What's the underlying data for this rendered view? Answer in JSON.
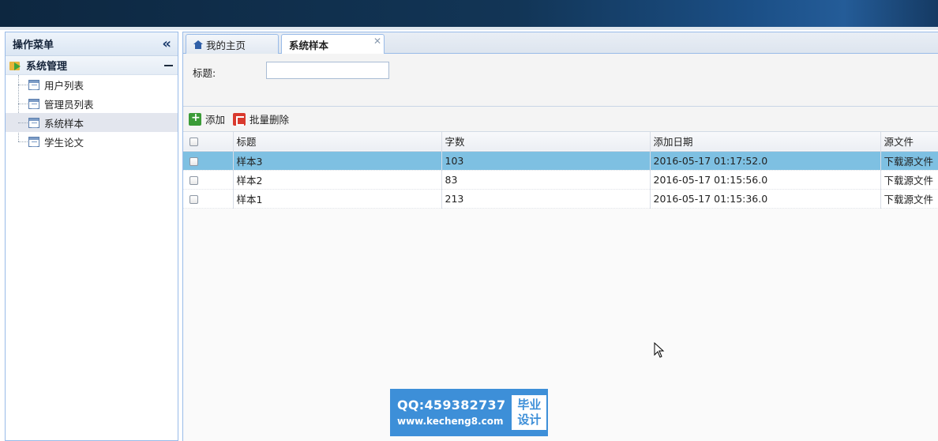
{
  "sidebar": {
    "title": "操作菜单",
    "group_title": "系统管理",
    "items": [
      {
        "label": "用户列表"
      },
      {
        "label": "管理员列表"
      },
      {
        "label": "系统样本"
      },
      {
        "label": "学生论文"
      }
    ],
    "selected_item": "系统样本"
  },
  "tabs": [
    {
      "label": "我的主页"
    },
    {
      "label": "系统样本"
    }
  ],
  "search": {
    "title_label": "标题:",
    "title_value": ""
  },
  "toolbar": {
    "add_label": "添加",
    "batch_delete_label": "批量删除"
  },
  "table": {
    "columns": [
      "标题",
      "字数",
      "添加日期",
      "源文件"
    ],
    "rows": [
      {
        "title": "样本3",
        "words": "103",
        "date": "2016-05-17 01:17:52.0",
        "file": "下载源文件"
      },
      {
        "title": "样本2",
        "words": "83",
        "date": "2016-05-17 01:15:56.0",
        "file": "下载源文件"
      },
      {
        "title": "样本1",
        "words": "213",
        "date": "2016-05-17 01:15:36.0",
        "file": "下载源文件"
      }
    ],
    "selected_row": 0
  },
  "watermark": {
    "qq": "QQ:459382737",
    "site": "www.kecheng8.com",
    "badge_line1": "毕业",
    "badge_line2": "设计"
  },
  "colors": {
    "selected_row": "#7ec0e2",
    "panel_border": "#99bbe8",
    "watermark_bg": "#3d8fd8"
  }
}
